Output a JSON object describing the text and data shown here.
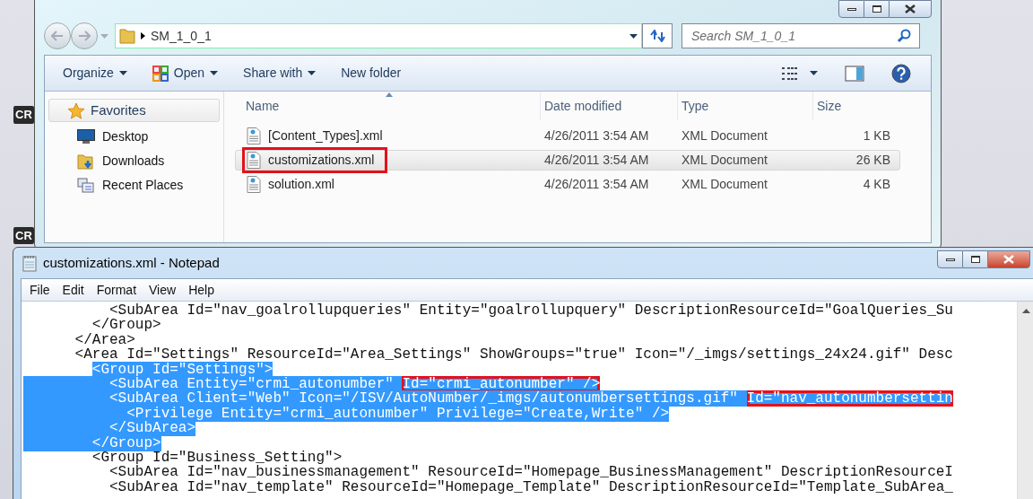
{
  "desktop": {
    "icon_labels": [
      "CR",
      "CR"
    ]
  },
  "explorer": {
    "breadcrumb": "SM_1_0_1",
    "search": {
      "placeholder": "Search SM_1_0_1"
    },
    "toolbar": [
      {
        "label": "Organize",
        "dropdown": true
      },
      {
        "label": "Open",
        "dropdown": true
      },
      {
        "label": "Share with",
        "dropdown": true
      },
      {
        "label": "New folder",
        "dropdown": false
      }
    ],
    "sidebar": {
      "header": "Favorites",
      "items": [
        {
          "label": "Desktop"
        },
        {
          "label": "Downloads"
        },
        {
          "label": "Recent Places"
        }
      ]
    },
    "columns": [
      "Name",
      "Date modified",
      "Type",
      "Size"
    ],
    "rows": [
      {
        "name": "[Content_Types].xml",
        "date": "4/26/2011 3:54 AM",
        "type": "XML Document",
        "size": "1 KB",
        "selected": false,
        "annotated": false
      },
      {
        "name": "customizations.xml",
        "date": "4/26/2011 3:54 AM",
        "type": "XML Document",
        "size": "26 KB",
        "selected": true,
        "annotated": true
      },
      {
        "name": "solution.xml",
        "date": "4/26/2011 3:54 AM",
        "type": "XML Document",
        "size": "4 KB",
        "selected": false,
        "annotated": false
      }
    ]
  },
  "notepad": {
    "title": "customizations.xml - Notepad",
    "menu": [
      "File",
      "Edit",
      "Format",
      "View",
      "Help"
    ],
    "lines": [
      {
        "selected": false,
        "segments": [
          {
            "text": "          <SubArea Id=\"nav_goalrollupqueries\" Entity=\"goalrollupquery\" DescriptionResourceId=\"GoalQueries_Su",
            "boxed": false
          }
        ]
      },
      {
        "selected": false,
        "segments": [
          {
            "text": "        </Group>",
            "boxed": false
          }
        ]
      },
      {
        "selected": false,
        "segments": [
          {
            "text": "      </Area>",
            "boxed": false
          }
        ]
      },
      {
        "selected": false,
        "segments": [
          {
            "text": "      <Area Id=\"Settings\" ResourceId=\"Area_Settings\" ShowGroups=\"true\" Icon=\"/_imgs/settings_24x24.gif\" Desc",
            "boxed": false
          }
        ]
      },
      {
        "selected": true,
        "segments": [
          {
            "text": "        <Group Id=\"Settings\">",
            "boxed": false
          }
        ]
      },
      {
        "selected": true,
        "segments": [
          {
            "text": "          <SubArea Entity=\"crmi_autonumber\" ",
            "boxed": false
          },
          {
            "text": "Id=\"crmi_autonumber\" />",
            "boxed": true
          }
        ]
      },
      {
        "selected": true,
        "segments": [
          {
            "text": "          <SubArea Client=\"Web\" Icon=\"/ISV/AutoNumber/_imgs/autonumbersettings.gif\" ",
            "boxed": false
          },
          {
            "text": "Id=\"nav_autonumbersettin",
            "boxed": true
          }
        ]
      },
      {
        "selected": true,
        "segments": [
          {
            "text": "            <Privilege Entity=\"crmi_autonumber\" Privilege=\"Create,Write\" />",
            "boxed": false
          }
        ]
      },
      {
        "selected": true,
        "segments": [
          {
            "text": "          </SubArea>",
            "boxed": false
          }
        ]
      },
      {
        "selected": true,
        "segments": [
          {
            "text": "        </Group>",
            "boxed": false
          }
        ]
      },
      {
        "selected": false,
        "segments": [
          {
            "text": "        <Group Id=\"Business_Setting\">",
            "boxed": false
          }
        ]
      },
      {
        "selected": false,
        "segments": [
          {
            "text": "          <SubArea Id=\"nav_businessmanagement\" ResourceId=\"Homepage_BusinessManagement\" DescriptionResourceI",
            "boxed": false
          }
        ]
      },
      {
        "selected": false,
        "segments": [
          {
            "text": "          <SubArea Id=\"nav_template\" ResourceId=\"Homepage_Template\" DescriptionResourceId=\"Template_SubArea_",
            "boxed": false
          }
        ]
      }
    ]
  }
}
